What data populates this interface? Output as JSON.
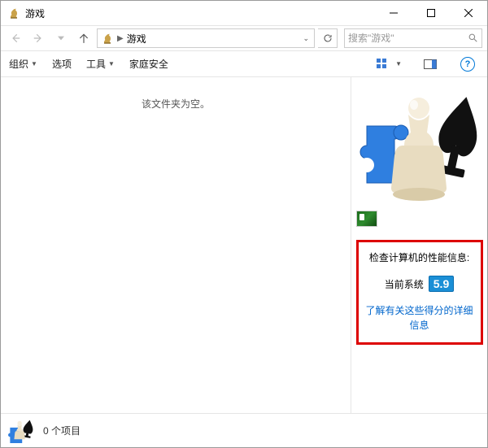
{
  "window": {
    "title": "游戏"
  },
  "breadcrumb": {
    "location": "游戏"
  },
  "search": {
    "placeholder": "搜索\"游戏\""
  },
  "toolbar": {
    "organize": "组织",
    "options": "选项",
    "tools": "工具",
    "family_safety": "家庭安全"
  },
  "main": {
    "empty_message": "该文件夹为空。"
  },
  "sidepane": {
    "perf_title": "检查计算机的性能信息:",
    "perf_label": "当前系统",
    "perf_score": "5.9",
    "perf_link": "了解有关这些得分的详细信息"
  },
  "statusbar": {
    "item_count": "0 个项目"
  },
  "colors": {
    "link": "#0066cc",
    "highlight_border": "#d00",
    "score_bg": "#1b8fd6"
  }
}
